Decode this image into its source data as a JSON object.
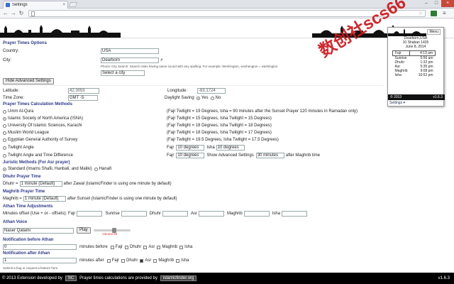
{
  "browser": {
    "tab_title": "Settings",
    "tab_close": "×",
    "back": "←",
    "forward": "→",
    "reload": "↻",
    "star": "☆",
    "menu_glyph": "≡",
    "win_min": "–",
    "win_max": "□",
    "win_close": "×"
  },
  "watermark": "数创社scs66",
  "form": {
    "heading": "Prayer Times Options",
    "country_label": "Country:",
    "country_value": "USA",
    "city_label": "City:",
    "city_value": "Dearborn",
    "city_hint": "Phonic City Search: Search cities having same sound with any spelling. For example: Weshington, woshengton = washington",
    "select_city": "Select a city",
    "hide_advanced": "Hide Advanced Settings",
    "latitude_label": "Latitude:",
    "latitude_value": "42.3055",
    "longitude_label": "Longitude:",
    "longitude_value": "-83.1724",
    "timezone_label": "Time Zone:",
    "timezone_value": "GMT -5",
    "dst_label": "Daylight Saving",
    "dst_yes": "Yes",
    "dst_no": "No",
    "calc_heading": "Prayer Times Calculation Methods",
    "methods": [
      {
        "name": "Umm Al-Qura",
        "desc": "(Fajr Twilight = 19 Degrees, Isha = 90 minutes after the Sunset Prayer 120 minutes in Ramadan only)",
        "selected": false
      },
      {
        "name": "Islamic Society of North America (ISNA)",
        "desc": "(Fajr Twilight = 15 Degrees, Isha Twilight = 15 Degrees)",
        "selected": true
      },
      {
        "name": "University Of Islamic Sciences, Karachi",
        "desc": "(Fajr Twilight = 18 Degrees, Isha Twilight = 18 Degrees)",
        "selected": false
      },
      {
        "name": "Muslim World League",
        "desc": "(Fajr Twilight = 18 Degrees, Isha Twilight = 17 Degrees)",
        "selected": false
      },
      {
        "name": "Egyptian General Authority of Survey",
        "desc": "(Fajr Twilight = 19.5 Degrees, Isha Twilight = 17.5 Degrees)",
        "selected": false
      }
    ],
    "twilight_angle": "Twilight Angle",
    "fajr": "Fajr",
    "fajr_deg": "10 degrees",
    "isha": "Isha",
    "isha_deg": "10 degrees",
    "twilight_angle_time": "Twilight Angle and Time Difference",
    "fajr2": "Fajr",
    "fajr2_deg": "10 degrees",
    "show_adv": "Show Advanced Settings",
    "minutes_after": "30 minutes",
    "after_maghrib": "after Maghrib time",
    "juristic_heading": "Juristic Methods (For Asr prayer)",
    "jur_standard": "Standard (Imams Shafii, Hanbali, and Maliki)",
    "jur_hanafi": "Hanafi",
    "dhuhr_heading": "Dhuhr Prayer Time",
    "dhuhr_label": "Dhuhr =",
    "dhuhr_value": "1 minute (Default)",
    "dhuhr_after": "after Zawal (IslamicFinder is using one minute by default)",
    "maghrib_heading": "Maghrib Prayer Time",
    "maghrib_label": "Maghrib =",
    "maghrib_value": "1 minute (Default)",
    "maghrib_after": "after Sunset (IslamicFinder is using one minute by default)",
    "adhan_adj_heading": "Athan Time Adjustments",
    "minutes_offset": "Minutes offset (Use + or - offsets): Fajr",
    "sunrise": "Sunrise",
    "dhuhr": "Dhuhr",
    "asr": "Asr",
    "maghrib": "Maghrib",
    "isha2": "Isha",
    "adhan_voice_heading": "Athan Voice",
    "voice_value": "Naser Qatami",
    "play": "Play",
    "volume": "Volume:60",
    "before_heading": "Notification before Athan",
    "before_value": "0",
    "minutes_before": "minutes before",
    "after_heading": "Notification after Athan",
    "after_value": "1",
    "minutes_after2": "minutes after",
    "notif_prayers": [
      "Fajr",
      "Dhuhr",
      "Asr",
      "Maghrib",
      "Isha"
    ],
    "submit_bug": "Submit a bug or request a feature here"
  },
  "popup": {
    "menu": "Menu",
    "city": "Dearborn,USA",
    "hijri": "10 Shaban 1435",
    "date": "June 8, 2014",
    "times": [
      {
        "name": "Fajr",
        "time": "4:13 am",
        "current": true
      },
      {
        "name": "Sunrise",
        "time": "5:56 am",
        "current": false
      },
      {
        "name": "Dhuhr",
        "time": "1:32 pm",
        "current": false
      },
      {
        "name": "Asr",
        "time": "5:35 pm",
        "current": false
      },
      {
        "name": "Maghrib",
        "time": "9:08 pm",
        "current": false
      },
      {
        "name": "Isha",
        "time": "10:52 pm",
        "current": false
      }
    ],
    "copyright": "© 2013",
    "version": "v1.6.3",
    "settings": "Settings"
  },
  "footer": {
    "copyright": "© 2013 Extension developed by",
    "logo": "SC",
    "provided": "Prayer times calculations are provided by",
    "islamicfinder": "islamicfinder.org",
    "version": "v1.6.3"
  }
}
